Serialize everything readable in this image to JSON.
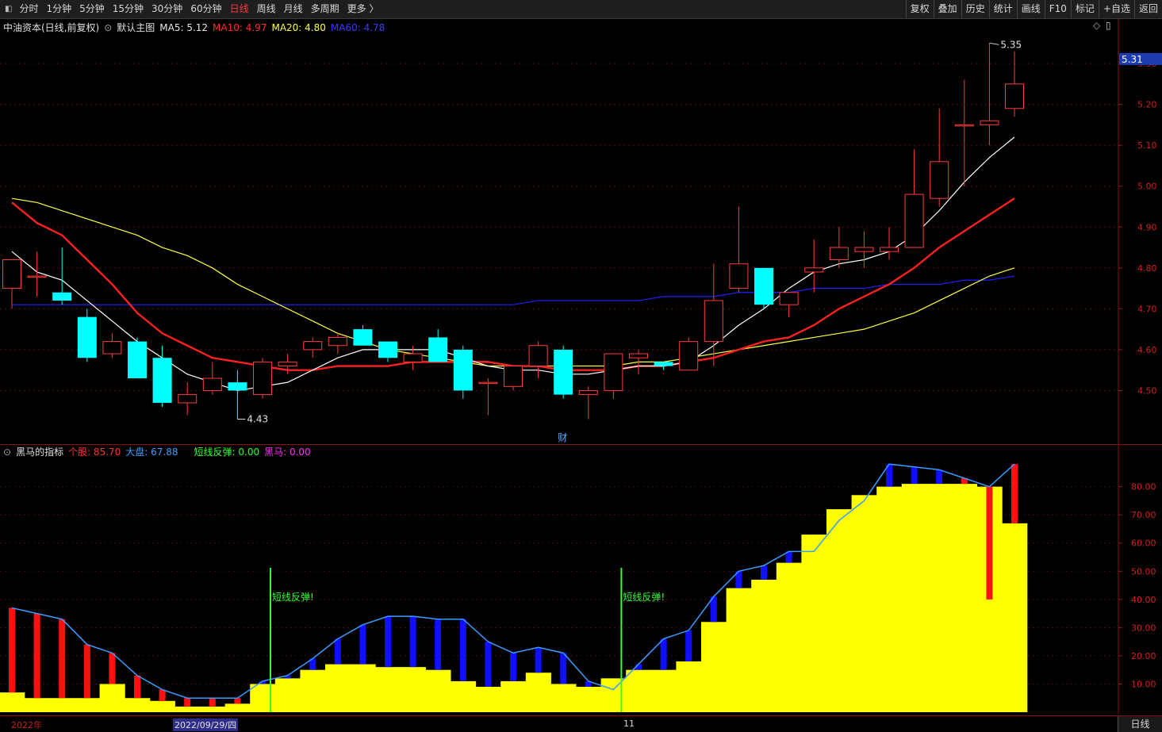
{
  "toolbar": {
    "left": [
      "分时",
      "1分钟",
      "5分钟",
      "15分钟",
      "30分钟",
      "60分钟",
      "日线",
      "周线",
      "月线",
      "多周期",
      "更多 〉"
    ],
    "active": "日线",
    "right": [
      "复权",
      "叠加",
      "历史",
      "统计",
      "画线",
      "F10",
      "标记",
      "+自选",
      "返回"
    ]
  },
  "main": {
    "title": "中油资本(日线,前复权)",
    "chart_name": "默认主图",
    "ma5": "MA5: 5.12",
    "ma10": "MA10: 4.97",
    "ma20": "MA20: 4.80",
    "ma60": "MA60: 4.78",
    "high_label": "5.35",
    "low_label": "4.43",
    "current_price": "5.31",
    "event_label": "财",
    "colors": {
      "up": "#ff3b3b",
      "down": "#00ffff",
      "ma5": "#ffffff",
      "ma10": "#ff2020",
      "ma20": "#ffff40",
      "ma60": "#2020ff"
    }
  },
  "indicator": {
    "name": "黑马的指标",
    "stock": "个股: 85.70",
    "market": "大盘: 67.88",
    "rebound": "短线反弹: 0.00",
    "horse": "黑马: 0.00",
    "signal_text": "短线反弹!"
  },
  "xaxis": {
    "year": "2022年",
    "date": "2022/09/29/四",
    "month": "11",
    "period": "日线"
  },
  "chart_data": [
    {
      "type": "candlestick",
      "title": "中油资本(日线,前复权)",
      "y_ticks": [
        4.5,
        4.6,
        4.7,
        4.8,
        4.9,
        5.0,
        5.1,
        5.2,
        5.3
      ],
      "ylim": [
        4.4,
        5.37
      ],
      "candles": [
        {
          "o": 4.75,
          "h": 4.8,
          "l": 4.7,
          "c": 4.82
        },
        {
          "o": 4.78,
          "h": 4.84,
          "l": 4.73,
          "c": 4.78
        },
        {
          "o": 4.74,
          "h": 4.85,
          "l": 4.71,
          "c": 4.72
        },
        {
          "o": 4.68,
          "h": 4.7,
          "l": 4.57,
          "c": 4.58
        },
        {
          "o": 4.59,
          "h": 4.64,
          "l": 4.58,
          "c": 4.62
        },
        {
          "o": 4.62,
          "h": 4.63,
          "l": 4.53,
          "c": 4.53
        },
        {
          "o": 4.58,
          "h": 4.61,
          "l": 4.46,
          "c": 4.47
        },
        {
          "o": 4.47,
          "h": 4.52,
          "l": 4.44,
          "c": 4.49
        },
        {
          "o": 4.5,
          "h": 4.57,
          "l": 4.49,
          "c": 4.53
        },
        {
          "o": 4.52,
          "h": 4.55,
          "l": 4.43,
          "c": 4.5
        },
        {
          "o": 4.49,
          "h": 4.58,
          "l": 4.48,
          "c": 4.57
        },
        {
          "o": 4.56,
          "h": 4.59,
          "l": 4.54,
          "c": 4.57
        },
        {
          "o": 4.6,
          "h": 4.63,
          "l": 4.58,
          "c": 4.62
        },
        {
          "o": 4.61,
          "h": 4.64,
          "l": 4.59,
          "c": 4.63
        },
        {
          "o": 4.65,
          "h": 4.66,
          "l": 4.61,
          "c": 4.61
        },
        {
          "o": 4.62,
          "h": 4.62,
          "l": 4.57,
          "c": 4.58
        },
        {
          "o": 4.57,
          "h": 4.61,
          "l": 4.55,
          "c": 4.59
        },
        {
          "o": 4.63,
          "h": 4.65,
          "l": 4.57,
          "c": 4.57
        },
        {
          "o": 4.6,
          "h": 4.61,
          "l": 4.48,
          "c": 4.5
        },
        {
          "o": 4.52,
          "h": 4.53,
          "l": 4.44,
          "c": 4.52
        },
        {
          "o": 4.51,
          "h": 4.56,
          "l": 4.5,
          "c": 4.56
        },
        {
          "o": 4.56,
          "h": 4.62,
          "l": 4.53,
          "c": 4.61
        },
        {
          "o": 4.6,
          "h": 4.61,
          "l": 4.48,
          "c": 4.49
        },
        {
          "o": 4.49,
          "h": 4.51,
          "l": 4.43,
          "c": 4.5
        },
        {
          "o": 4.5,
          "h": 4.59,
          "l": 4.48,
          "c": 4.59
        },
        {
          "o": 4.58,
          "h": 4.6,
          "l": 4.54,
          "c": 4.59
        },
        {
          "o": 4.57,
          "h": 4.57,
          "l": 4.55,
          "c": 4.56
        },
        {
          "o": 4.55,
          "h": 4.63,
          "l": 4.55,
          "c": 4.62
        },
        {
          "o": 4.62,
          "h": 4.81,
          "l": 4.56,
          "c": 4.72
        },
        {
          "o": 4.75,
          "h": 4.95,
          "l": 4.74,
          "c": 4.81
        },
        {
          "o": 4.8,
          "h": 4.8,
          "l": 4.7,
          "c": 4.71
        },
        {
          "o": 4.71,
          "h": 4.74,
          "l": 4.68,
          "c": 4.74
        },
        {
          "o": 4.79,
          "h": 4.87,
          "l": 4.74,
          "c": 4.8
        },
        {
          "o": 4.82,
          "h": 4.9,
          "l": 4.8,
          "c": 4.85
        },
        {
          "o": 4.84,
          "h": 4.89,
          "l": 4.8,
          "c": 4.85
        },
        {
          "o": 4.84,
          "h": 4.9,
          "l": 4.82,
          "c": 4.85
        },
        {
          "o": 4.85,
          "h": 5.09,
          "l": 4.85,
          "c": 4.98
        },
        {
          "o": 4.97,
          "h": 5.19,
          "l": 4.95,
          "c": 5.06
        },
        {
          "o": 5.15,
          "h": 5.26,
          "l": 5.0,
          "c": 5.15
        },
        {
          "o": 5.15,
          "h": 5.35,
          "l": 5.1,
          "c": 5.16
        },
        {
          "o": 5.19,
          "h": 5.33,
          "l": 5.17,
          "c": 5.25
        }
      ],
      "ma5": [
        4.84,
        4.79,
        4.77,
        4.72,
        4.67,
        4.62,
        4.58,
        4.54,
        4.52,
        4.5,
        4.51,
        4.52,
        4.55,
        4.58,
        4.6,
        4.6,
        4.6,
        4.6,
        4.58,
        4.56,
        4.55,
        4.55,
        4.54,
        4.54,
        4.55,
        4.56,
        4.56,
        4.57,
        4.61,
        4.66,
        4.7,
        4.75,
        4.79,
        4.81,
        4.82,
        4.84,
        4.88,
        4.94,
        5.01,
        5.07,
        5.12
      ],
      "ma10": [
        4.96,
        4.91,
        4.88,
        4.82,
        4.76,
        4.69,
        4.64,
        4.61,
        4.58,
        4.57,
        4.56,
        4.55,
        4.55,
        4.56,
        4.56,
        4.56,
        4.57,
        4.57,
        4.57,
        4.57,
        4.56,
        4.56,
        4.55,
        4.55,
        4.55,
        4.56,
        4.56,
        4.57,
        4.58,
        4.6,
        4.62,
        4.63,
        4.66,
        4.7,
        4.73,
        4.76,
        4.8,
        4.85,
        4.89,
        4.93,
        4.97
      ],
      "ma20": [
        4.97,
        4.96,
        4.94,
        4.92,
        4.9,
        4.88,
        4.85,
        4.83,
        4.8,
        4.76,
        4.73,
        4.7,
        4.67,
        4.64,
        4.62,
        4.6,
        4.59,
        4.58,
        4.57,
        4.56,
        4.56,
        4.56,
        4.56,
        4.56,
        4.56,
        4.57,
        4.57,
        4.58,
        4.59,
        4.6,
        4.61,
        4.62,
        4.63,
        4.64,
        4.65,
        4.67,
        4.69,
        4.72,
        4.75,
        4.78,
        4.8
      ],
      "ma60": [
        4.71,
        4.71,
        4.71,
        4.71,
        4.71,
        4.71,
        4.71,
        4.71,
        4.71,
        4.71,
        4.71,
        4.71,
        4.71,
        4.71,
        4.71,
        4.71,
        4.71,
        4.71,
        4.71,
        4.71,
        4.71,
        4.72,
        4.72,
        4.72,
        4.72,
        4.72,
        4.73,
        4.73,
        4.73,
        4.74,
        4.74,
        4.74,
        4.75,
        4.75,
        4.75,
        4.76,
        4.76,
        4.76,
        4.77,
        4.77,
        4.78
      ]
    },
    {
      "type": "bar",
      "title": "黑马的指标",
      "y_ticks": [
        10,
        20,
        30,
        40,
        50,
        60,
        70,
        80
      ],
      "ylim": [
        0,
        92
      ],
      "line": [
        37,
        35,
        33,
        24,
        21,
        13,
        8,
        5,
        5,
        5,
        11,
        13,
        19,
        26,
        31,
        34,
        34,
        33,
        33,
        25,
        21,
        23,
        21,
        11,
        8,
        17,
        26,
        29,
        41,
        50,
        52,
        57,
        57,
        68,
        75,
        88,
        87,
        86,
        83,
        80,
        88
      ],
      "yellow": [
        7,
        5,
        5,
        5,
        10,
        5,
        4,
        2,
        2,
        3,
        10,
        12,
        15,
        17,
        17,
        16,
        16,
        15,
        11,
        9,
        11,
        14,
        10,
        9,
        12,
        15,
        15,
        18,
        32,
        44,
        47,
        53,
        63,
        72,
        77,
        80,
        81,
        81,
        81,
        80,
        67
      ],
      "red": [
        null,
        null,
        null,
        null,
        null,
        null,
        null,
        null,
        null,
        null,
        null,
        null,
        null,
        null,
        null,
        null,
        null,
        null,
        null,
        null,
        null,
        null,
        null,
        null,
        null,
        null,
        null,
        null,
        null,
        null,
        null,
        null,
        null,
        null,
        null,
        null,
        null,
        null,
        null,
        40,
        null
      ],
      "signals_at_index": [
        10,
        24
      ]
    }
  ]
}
